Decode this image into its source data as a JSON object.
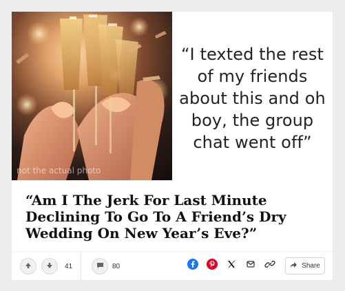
{
  "card": {
    "photo_caption": "not the actual photo",
    "quote": "“I texted the rest of my friends about this and oh boy, the group chat went off”",
    "headline": "“Am I The Jerk For Last Minute Declining To Go To A Friend’s Dry Wedding On New Year’s Eve?”"
  },
  "toolbar": {
    "vote_count": "41",
    "comment_count": "80",
    "share_label": "Share"
  },
  "icons": {
    "upvote": "arrow-up-icon",
    "downvote": "arrow-down-icon",
    "comment": "comment-icon",
    "facebook": "facebook-icon",
    "pinterest": "pinterest-icon",
    "x": "x-icon",
    "email": "email-icon",
    "link": "link-icon",
    "share": "share-arrow-icon"
  },
  "colors": {
    "facebook": "#1877f2",
    "pinterest": "#e60023",
    "background": "#ececec",
    "card": "#ffffff"
  }
}
